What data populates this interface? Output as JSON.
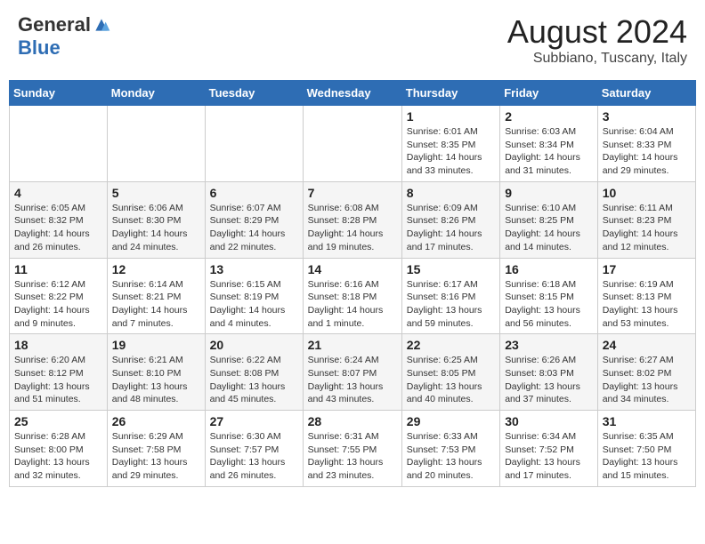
{
  "logo": {
    "general": "General",
    "blue": "Blue"
  },
  "title": {
    "month": "August 2024",
    "location": "Subbiano, Tuscany, Italy"
  },
  "headers": [
    "Sunday",
    "Monday",
    "Tuesday",
    "Wednesday",
    "Thursday",
    "Friday",
    "Saturday"
  ],
  "weeks": [
    [
      {
        "day": "",
        "info": ""
      },
      {
        "day": "",
        "info": ""
      },
      {
        "day": "",
        "info": ""
      },
      {
        "day": "",
        "info": ""
      },
      {
        "day": "1",
        "info": "Sunrise: 6:01 AM\nSunset: 8:35 PM\nDaylight: 14 hours and 33 minutes."
      },
      {
        "day": "2",
        "info": "Sunrise: 6:03 AM\nSunset: 8:34 PM\nDaylight: 14 hours and 31 minutes."
      },
      {
        "day": "3",
        "info": "Sunrise: 6:04 AM\nSunset: 8:33 PM\nDaylight: 14 hours and 29 minutes."
      }
    ],
    [
      {
        "day": "4",
        "info": "Sunrise: 6:05 AM\nSunset: 8:32 PM\nDaylight: 14 hours and 26 minutes."
      },
      {
        "day": "5",
        "info": "Sunrise: 6:06 AM\nSunset: 8:30 PM\nDaylight: 14 hours and 24 minutes."
      },
      {
        "day": "6",
        "info": "Sunrise: 6:07 AM\nSunset: 8:29 PM\nDaylight: 14 hours and 22 minutes."
      },
      {
        "day": "7",
        "info": "Sunrise: 6:08 AM\nSunset: 8:28 PM\nDaylight: 14 hours and 19 minutes."
      },
      {
        "day": "8",
        "info": "Sunrise: 6:09 AM\nSunset: 8:26 PM\nDaylight: 14 hours and 17 minutes."
      },
      {
        "day": "9",
        "info": "Sunrise: 6:10 AM\nSunset: 8:25 PM\nDaylight: 14 hours and 14 minutes."
      },
      {
        "day": "10",
        "info": "Sunrise: 6:11 AM\nSunset: 8:23 PM\nDaylight: 14 hours and 12 minutes."
      }
    ],
    [
      {
        "day": "11",
        "info": "Sunrise: 6:12 AM\nSunset: 8:22 PM\nDaylight: 14 hours and 9 minutes."
      },
      {
        "day": "12",
        "info": "Sunrise: 6:14 AM\nSunset: 8:21 PM\nDaylight: 14 hours and 7 minutes."
      },
      {
        "day": "13",
        "info": "Sunrise: 6:15 AM\nSunset: 8:19 PM\nDaylight: 14 hours and 4 minutes."
      },
      {
        "day": "14",
        "info": "Sunrise: 6:16 AM\nSunset: 8:18 PM\nDaylight: 14 hours and 1 minute."
      },
      {
        "day": "15",
        "info": "Sunrise: 6:17 AM\nSunset: 8:16 PM\nDaylight: 13 hours and 59 minutes."
      },
      {
        "day": "16",
        "info": "Sunrise: 6:18 AM\nSunset: 8:15 PM\nDaylight: 13 hours and 56 minutes."
      },
      {
        "day": "17",
        "info": "Sunrise: 6:19 AM\nSunset: 8:13 PM\nDaylight: 13 hours and 53 minutes."
      }
    ],
    [
      {
        "day": "18",
        "info": "Sunrise: 6:20 AM\nSunset: 8:12 PM\nDaylight: 13 hours and 51 minutes."
      },
      {
        "day": "19",
        "info": "Sunrise: 6:21 AM\nSunset: 8:10 PM\nDaylight: 13 hours and 48 minutes."
      },
      {
        "day": "20",
        "info": "Sunrise: 6:22 AM\nSunset: 8:08 PM\nDaylight: 13 hours and 45 minutes."
      },
      {
        "day": "21",
        "info": "Sunrise: 6:24 AM\nSunset: 8:07 PM\nDaylight: 13 hours and 43 minutes."
      },
      {
        "day": "22",
        "info": "Sunrise: 6:25 AM\nSunset: 8:05 PM\nDaylight: 13 hours and 40 minutes."
      },
      {
        "day": "23",
        "info": "Sunrise: 6:26 AM\nSunset: 8:03 PM\nDaylight: 13 hours and 37 minutes."
      },
      {
        "day": "24",
        "info": "Sunrise: 6:27 AM\nSunset: 8:02 PM\nDaylight: 13 hours and 34 minutes."
      }
    ],
    [
      {
        "day": "25",
        "info": "Sunrise: 6:28 AM\nSunset: 8:00 PM\nDaylight: 13 hours and 32 minutes."
      },
      {
        "day": "26",
        "info": "Sunrise: 6:29 AM\nSunset: 7:58 PM\nDaylight: 13 hours and 29 minutes."
      },
      {
        "day": "27",
        "info": "Sunrise: 6:30 AM\nSunset: 7:57 PM\nDaylight: 13 hours and 26 minutes."
      },
      {
        "day": "28",
        "info": "Sunrise: 6:31 AM\nSunset: 7:55 PM\nDaylight: 13 hours and 23 minutes."
      },
      {
        "day": "29",
        "info": "Sunrise: 6:33 AM\nSunset: 7:53 PM\nDaylight: 13 hours and 20 minutes."
      },
      {
        "day": "30",
        "info": "Sunrise: 6:34 AM\nSunset: 7:52 PM\nDaylight: 13 hours and 17 minutes."
      },
      {
        "day": "31",
        "info": "Sunrise: 6:35 AM\nSunset: 7:50 PM\nDaylight: 13 hours and 15 minutes."
      }
    ]
  ]
}
